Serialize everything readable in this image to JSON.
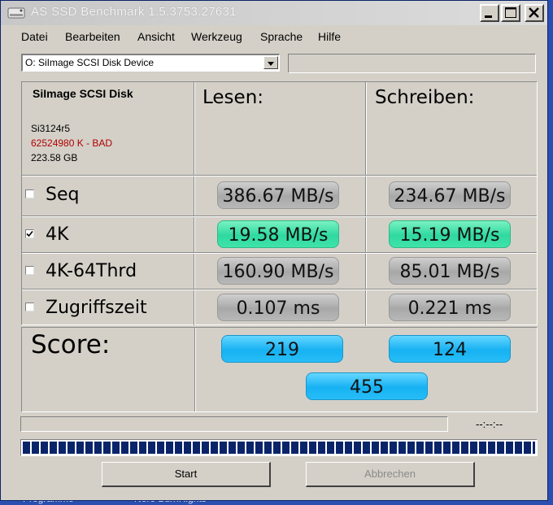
{
  "window": {
    "title": "AS SSD Benchmark 1.5.3753.27631"
  },
  "menu": [
    "Datei",
    "Bearbeiten",
    "Ansicht",
    "Werkzeug",
    "Sprache",
    "Hilfe"
  ],
  "drive": {
    "selected": "O: SiImage  SCSI Disk Device"
  },
  "disk": {
    "name": "SiImage  SCSI Disk",
    "firmware": "Si3124r5",
    "alignment": "62524980 K - BAD",
    "size": "223.58 GB"
  },
  "columns": {
    "read": "Lesen:",
    "write": "Schreiben:"
  },
  "tests": [
    {
      "label": "Seq",
      "checked": false,
      "read": "386.67 MB/s",
      "write": "234.67 MB/s",
      "highlight": false
    },
    {
      "label": "4K",
      "checked": true,
      "read": "19.58 MB/s",
      "write": "15.19 MB/s",
      "highlight": true
    },
    {
      "label": "4K-64Thrd",
      "checked": false,
      "read": "160.90 MB/s",
      "write": "85.01 MB/s",
      "highlight": false
    },
    {
      "label": "Zugriffszeit",
      "checked": false,
      "read": "0.107 ms",
      "write": "0.221 ms",
      "highlight": false
    }
  ],
  "score": {
    "label": "Score:",
    "read": "219",
    "write": "124",
    "total": "455"
  },
  "progress": {
    "elapsed": "--:--:--",
    "overall": 1.0
  },
  "buttons": {
    "start": "Start",
    "cancel": "Abbrechen"
  },
  "background": {
    "left": "Programme",
    "right": "Nero BurnRights"
  },
  "colors": {
    "highlight_green": "#2fd9a0",
    "score_blue": "#16b2f3",
    "bad_red": "#b00000",
    "progress_blue": "#0a246a"
  }
}
